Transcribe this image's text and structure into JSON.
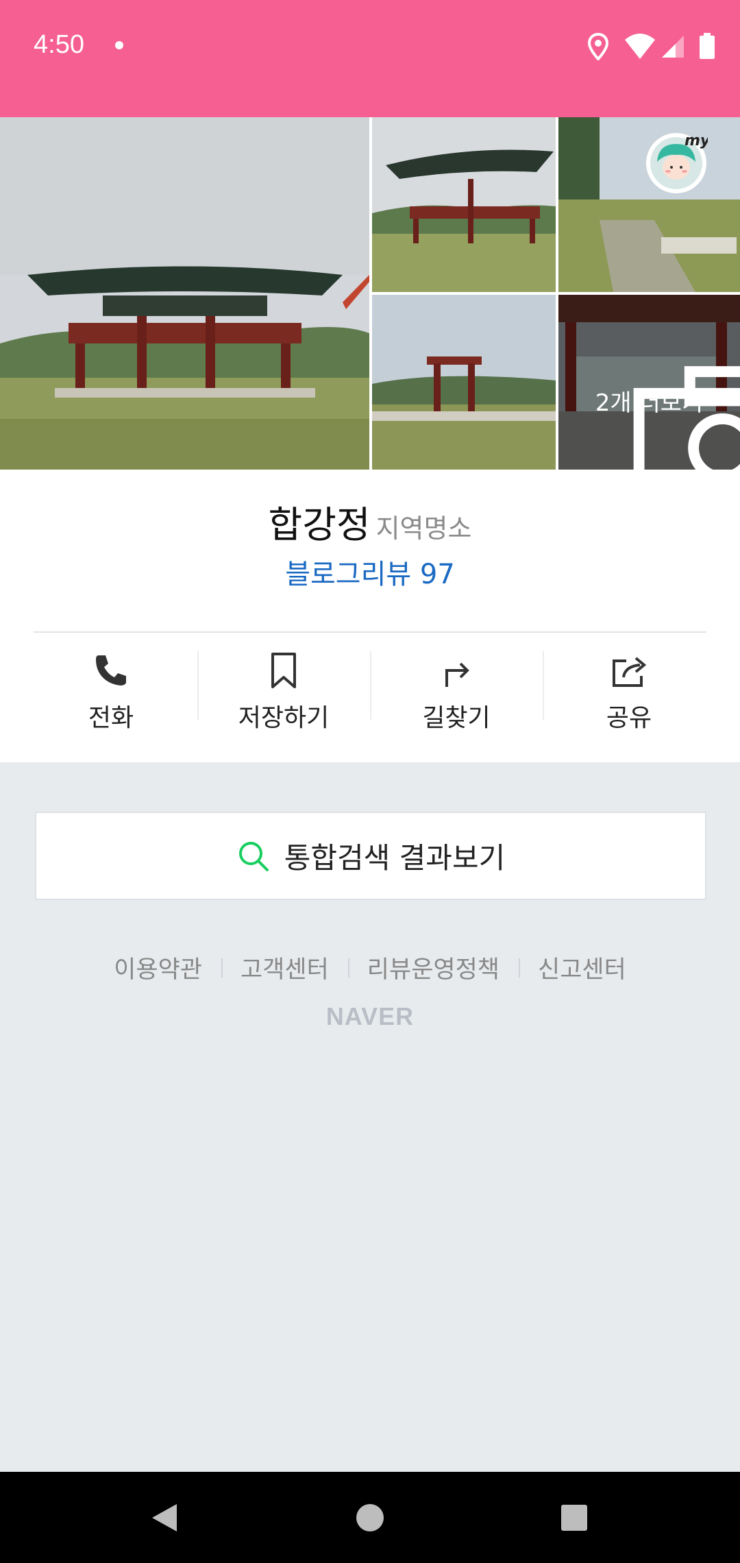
{
  "status_bar": {
    "time": "4:50",
    "icons": [
      "notification-dot-icon",
      "location-icon",
      "wifi-icon",
      "signal-icon",
      "battery-icon"
    ],
    "background": "#f65f92"
  },
  "photos": {
    "count": 5,
    "more_label": "2개 더보기",
    "badge_text": "my"
  },
  "place": {
    "name": "합강정",
    "category": "지역명소",
    "blog_review_label": "블로그리뷰 97"
  },
  "actions": [
    {
      "label": "전화",
      "icon": "phone-icon"
    },
    {
      "label": "저장하기",
      "icon": "bookmark-icon"
    },
    {
      "label": "길찾기",
      "icon": "directions-icon"
    },
    {
      "label": "공유",
      "icon": "share-icon"
    }
  ],
  "search": {
    "label": "통합검색 결과보기",
    "icon": "search-icon",
    "icon_color": "#19ce60"
  },
  "footer": {
    "links": [
      "이용약관",
      "고객센터",
      "리뷰운영정책",
      "신고센터"
    ],
    "logo": "NAVER"
  },
  "nav_bar": {
    "buttons": [
      "back-icon",
      "home-icon",
      "recents-icon"
    ]
  },
  "colors": {
    "accent": "#f65f92",
    "link": "#1a6ac3",
    "page_bg": "#e8ebee"
  }
}
